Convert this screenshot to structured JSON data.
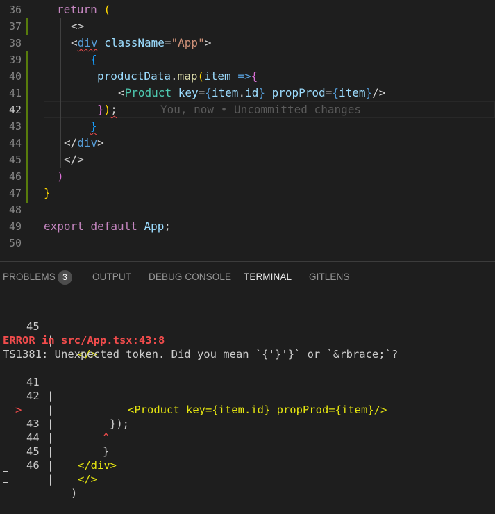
{
  "editor": {
    "lines": [
      {
        "num": "36",
        "code": "return ("
      },
      {
        "num": "37",
        "code": "<>"
      },
      {
        "num": "38",
        "code": "<div className=\"App\">"
      },
      {
        "num": "39",
        "code": "{"
      },
      {
        "num": "40",
        "code": "productData.map(item =>{"
      },
      {
        "num": "41",
        "code": "<Product key={item.id} propProd={item}/>"
      },
      {
        "num": "42",
        "code": "});"
      },
      {
        "num": "43",
        "code": "}"
      },
      {
        "num": "44",
        "code": "</div>"
      },
      {
        "num": "45",
        "code": "</>"
      },
      {
        "num": "46",
        "code": ")"
      },
      {
        "num": "47",
        "code": "}"
      },
      {
        "num": "48",
        "code": ""
      },
      {
        "num": "49",
        "code": "export default App;"
      },
      {
        "num": "50",
        "code": ""
      }
    ],
    "blame": "You, now • Uncommitted changes"
  },
  "panel": {
    "tabs": {
      "problems": "PROBLEMS",
      "problems_count": "3",
      "output": "OUTPUT",
      "debug_console": "DEBUG CONSOLE",
      "terminal": "TERMINAL",
      "gitlens": "GITLENS"
    },
    "active_tab": "TERMINAL"
  },
  "terminal": {
    "line_45_top": {
      "num": "45",
      "sep": "|",
      "code": "</>"
    },
    "error_heading": "ERROR in src/App.tsx:43:8",
    "error_message": "TS1381: Unexpected token. Did you mean `{'}'}` or `&rbrace;`?",
    "snippet": [
      {
        "marker": "",
        "num": "41",
        "sep": "|",
        "code": "<Product key={item.id} propProd={item}/>"
      },
      {
        "marker": "",
        "num": "42",
        "sep": "|",
        "code": "});"
      },
      {
        "marker": ">",
        "num": "43",
        "sep": "|",
        "code": "}"
      },
      {
        "marker": "",
        "num": "",
        "sep": "|",
        "code": "^"
      },
      {
        "marker": "",
        "num": "44",
        "sep": "|",
        "code": "</div>"
      },
      {
        "marker": "",
        "num": "45",
        "sep": "|",
        "code": "</>"
      },
      {
        "marker": "",
        "num": "46",
        "sep": "|",
        "code": ")"
      }
    ]
  },
  "colors": {
    "background": "#1e1e1e",
    "error": "#f14c4c",
    "tag": "#569cd6",
    "keyword": "#c586c0",
    "string": "#ce9178",
    "git_added": "#587c0c"
  }
}
